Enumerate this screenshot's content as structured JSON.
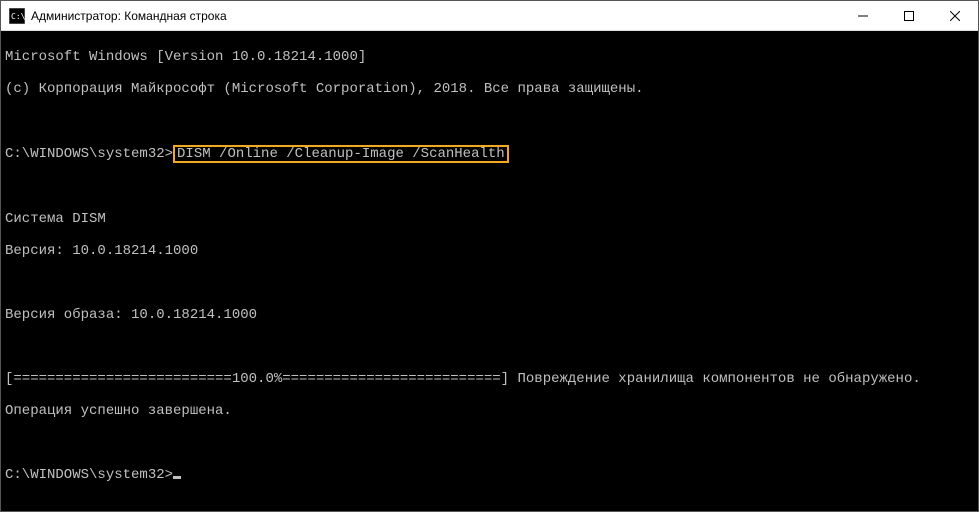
{
  "titlebar": {
    "title": "Администратор: Командная строка"
  },
  "terminal": {
    "line1": "Microsoft Windows [Version 10.0.18214.1000]",
    "line2": "(c) Корпорация Майкрософт (Microsoft Corporation), 2018. Все права защищены.",
    "prompt1": "C:\\WINDOWS\\system32>",
    "command": "DISM /Online /Cleanup-Image /ScanHealth",
    "line_system": "Cистема DISM",
    "line_version": "Версия: 10.0.18214.1000",
    "line_image_version": "Версия образа: 10.0.18214.1000",
    "progress": "[==========================100.0%==========================] Повреждение хранилища компонентов не обнаружено.",
    "line_complete": "Операция успешно завершена.",
    "prompt2": "C:\\WINDOWS\\system32>"
  }
}
